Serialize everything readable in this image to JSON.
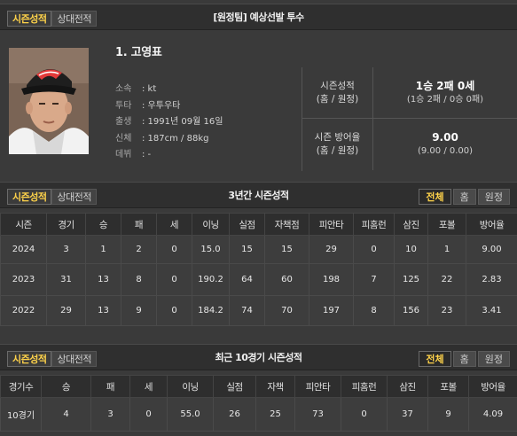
{
  "section1": {
    "tabs": [
      "시즌성적",
      "상대전적"
    ],
    "title": "[원정팀] 예상선발 투수"
  },
  "pitcher": {
    "name": "1. 고영표",
    "info": [
      {
        "key": "소속",
        "value": ": kt"
      },
      {
        "key": "투타",
        "value": ": 우투우타"
      },
      {
        "key": "출생",
        "value": ": 1991년 09월 16일"
      },
      {
        "key": "신체",
        "value": ": 187cm / 88kg"
      },
      {
        "key": "데뷔",
        "value": ": -"
      }
    ],
    "season_record_label": [
      "시즌성적",
      "(홈 / 원정)"
    ],
    "season_record_main": "1승 2패 0세",
    "season_record_sub": "(1승 2패 / 0승 0패)",
    "era_label": [
      "시즌 방어율",
      "(홈 / 원정)"
    ],
    "era_main": "9.00",
    "era_sub": "(9.00 / 0.00)"
  },
  "section2": {
    "tabs": [
      "시즌성적",
      "상대전적"
    ],
    "title": "3년간 시즌성적",
    "filters": [
      "전체",
      "홈",
      "원정"
    ],
    "headers": [
      "시즌",
      "경기",
      "승",
      "패",
      "세",
      "이닝",
      "실점",
      "자책점",
      "피안타",
      "피홈런",
      "삼진",
      "포볼",
      "방어율"
    ],
    "rows": [
      [
        "2024",
        "3",
        "1",
        "2",
        "0",
        "15.0",
        "15",
        "15",
        "29",
        "0",
        "10",
        "1",
        "9.00"
      ],
      [
        "2023",
        "31",
        "13",
        "8",
        "0",
        "190.2",
        "64",
        "60",
        "198",
        "7",
        "125",
        "22",
        "2.83"
      ],
      [
        "2022",
        "29",
        "13",
        "9",
        "0",
        "184.2",
        "74",
        "70",
        "197",
        "8",
        "156",
        "23",
        "3.41"
      ]
    ]
  },
  "section3": {
    "tabs": [
      "시즌성적",
      "상대전적"
    ],
    "title": "최근 10경기 시즌성적",
    "filters": [
      "전체",
      "홈",
      "원정"
    ],
    "headers": [
      "경기수",
      "승",
      "패",
      "세",
      "이닝",
      "실점",
      "자책",
      "피안타",
      "피홈런",
      "삼진",
      "포볼",
      "방어율"
    ],
    "rows": [
      [
        "10경기",
        "4",
        "3",
        "0",
        "55.0",
        "26",
        "25",
        "73",
        "0",
        "37",
        "9",
        "4.09"
      ]
    ]
  },
  "colors": {
    "accent": "#ffd34a",
    "bar_bg": "#2f2f2f",
    "body_bg": "#3a3a3a"
  }
}
